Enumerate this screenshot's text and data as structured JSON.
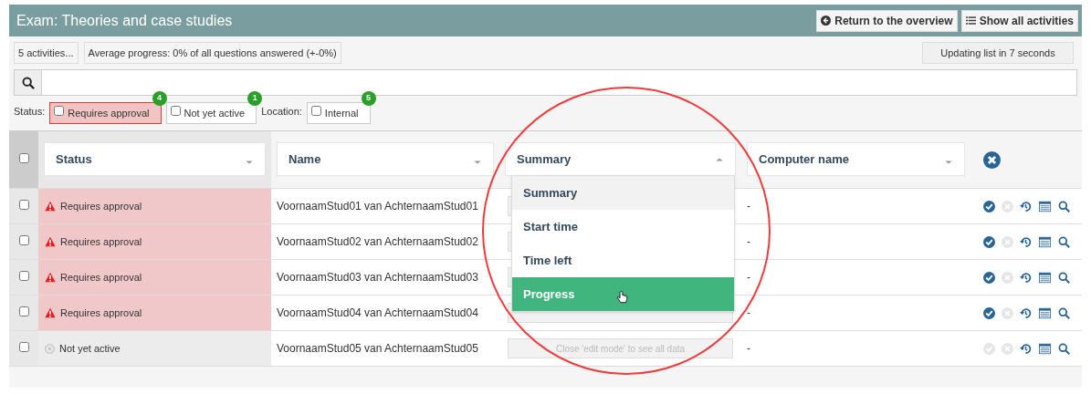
{
  "header": {
    "title": "Exam: Theories and case studies",
    "buttons": [
      {
        "kind": "back",
        "label": "Return to the overview"
      },
      {
        "kind": "list",
        "label": "Show all activities"
      }
    ]
  },
  "info": {
    "activities": "5 activities...",
    "progress": "Average progress: 0% of all questions answered (+-0%)",
    "update": "Updating list in 7 seconds"
  },
  "filters": [
    {
      "kind": "label",
      "text": "Status:"
    },
    {
      "kind": "check",
      "label": "Requires approval",
      "checked": false,
      "highlighted": true,
      "count": "4"
    },
    {
      "kind": "check",
      "label": "Not yet active",
      "checked": false,
      "highlighted": false,
      "count": "1"
    },
    {
      "kind": "label",
      "text": "Location:"
    },
    {
      "kind": "check",
      "label": "Internal",
      "checked": false,
      "highlighted": false,
      "count": "5"
    }
  ],
  "table": {
    "all_checked": false,
    "columns": [
      {
        "label": "Status",
        "open": false
      },
      {
        "label": "Name",
        "open": false
      },
      {
        "label": "Summary",
        "open": true
      },
      {
        "label": "Computer name",
        "open": false
      }
    ],
    "rows": [
      {
        "checked": false,
        "kind": "requires_approval",
        "status_text": "Requires approval",
        "name": "VoornaamStud01 van AchternaamStud01",
        "computer": "-",
        "approve_enabled": true
      },
      {
        "checked": false,
        "kind": "requires_approval",
        "status_text": "Requires approval",
        "name": "VoornaamStud02 van AchternaamStud02",
        "computer": "-",
        "approve_enabled": true
      },
      {
        "checked": false,
        "kind": "requires_approval",
        "status_text": "Requires approval",
        "name": "VoornaamStud03 van AchternaamStud03",
        "computer": "-",
        "approve_enabled": true
      },
      {
        "checked": false,
        "kind": "requires_approval",
        "status_text": "Requires approval",
        "name": "VoornaamStud04 van AchternaamStud04",
        "computer": "-",
        "approve_enabled": true
      },
      {
        "checked": false,
        "kind": "not_yet_active",
        "status_text": "Not yet active",
        "name": "VoornaamStud05 van AchternaamStud05",
        "summary": "Close 'edit mode' to see all data",
        "computer": "-",
        "approve_enabled": false
      }
    ]
  },
  "dropdown": {
    "options": [
      {
        "label": "Summary",
        "selected": true,
        "hovered": false
      },
      {
        "label": "Start time",
        "selected": false,
        "hovered": false
      },
      {
        "label": "Time left",
        "selected": false,
        "hovered": false
      },
      {
        "label": "Progress",
        "selected": false,
        "hovered": true
      }
    ]
  }
}
